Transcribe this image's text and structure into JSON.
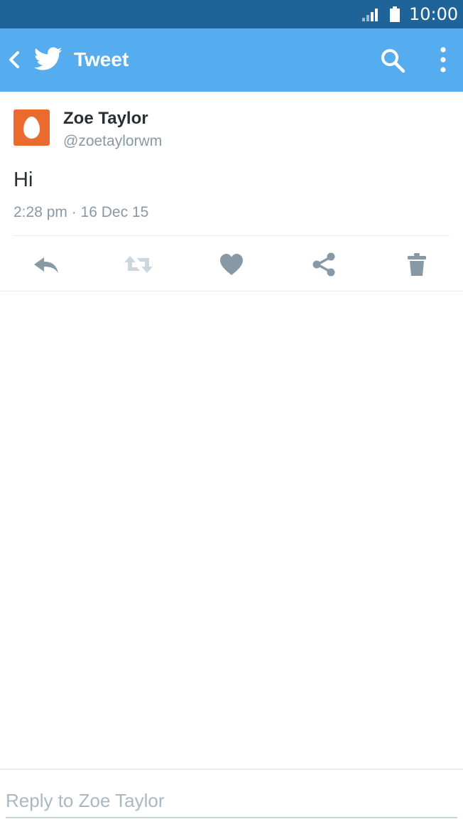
{
  "status_bar": {
    "time": "10:00",
    "icons": [
      "signal-icon",
      "battery-icon"
    ]
  },
  "app_bar": {
    "title": "Tweet",
    "icons": [
      "back-arrow-icon",
      "twitter-bird-icon",
      "search-icon",
      "more-vert-icon"
    ]
  },
  "tweet": {
    "author_name": "Zoe Taylor",
    "author_handle": "@zoetaylorwm",
    "text": "Hi",
    "timestamp": "2:28 pm · 16 Dec 15",
    "avatar_icon": "egg-avatar-icon"
  },
  "actions": [
    "reply-icon",
    "retweet-icon",
    "like-icon",
    "share-icon",
    "delete-icon"
  ],
  "reply": {
    "placeholder": "Reply to Zoe Taylor",
    "value": ""
  },
  "colors": {
    "status_bar": "#1f6499",
    "app_bar": "#55acee",
    "avatar": "#eb6a2e",
    "action_icon": "#8899a6",
    "retweet_icon": "#ccd6dd",
    "text_primary": "#292f33",
    "text_secondary": "#8899a6"
  }
}
